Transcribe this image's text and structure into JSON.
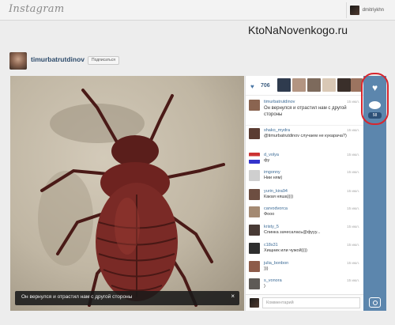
{
  "topbar": {
    "logo": "Instagram",
    "username": "dmitriykhn"
  },
  "watermark": "KtoNaNovenkogo.ru",
  "profile": {
    "name": "timurbatrutdinov",
    "follow_label": "Подписаться"
  },
  "photo": {
    "caption": "Он вернулся и отрастил нам с другой стороны",
    "close": "×"
  },
  "likes": {
    "count": "706"
  },
  "comments": [
    {
      "user": "timurbatrutdinov",
      "time": "15 июл.",
      "text": "Он вернулся и отрастил нам с другой стороны"
    },
    {
      "user": "shako_mydra",
      "time": "15 июл.",
      "text": "@timurbatrutdinov случаем не кукарача?)"
    },
    {
      "user": "d_volya",
      "time": "15 июл.",
      "text": "фу"
    },
    {
      "user": "imgonny",
      "time": "15 июл.",
      "text": "Нии ням)"
    },
    {
      "user": "yurin_kira94",
      "time": "15 июл.",
      "text": "Какая няша))))"
    },
    {
      "user": "carvodvorca",
      "time": "15 июл.",
      "text": "Фооо"
    },
    {
      "user": "kristy_5",
      "time": "15 июл.",
      "text": "Спинка зачесалась@фууу..."
    },
    {
      "user": "c18s31",
      "time": "15 июл.",
      "text": "Хищник или чужой))))"
    },
    {
      "user": "julia_bonbon",
      "time": "15 июл.",
      "text": ")))"
    },
    {
      "user": "s_vonora",
      "time": "15 июл.",
      "text": ")"
    }
  ],
  "comment_input": {
    "placeholder": "Комментарий"
  },
  "actions": {
    "comment_count": "58"
  }
}
